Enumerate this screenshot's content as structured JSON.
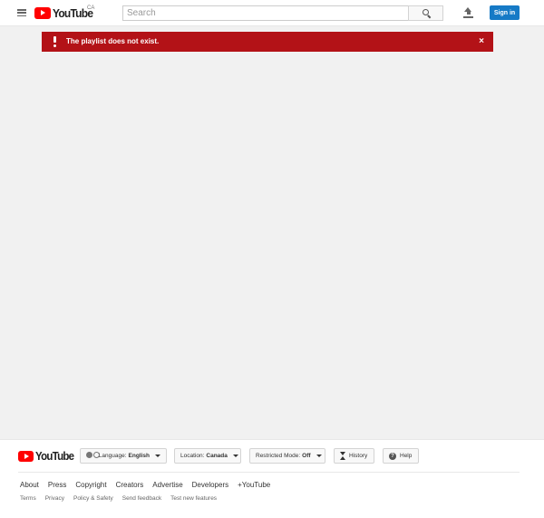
{
  "header": {
    "logo_text": "YouTube",
    "region": "CA",
    "search_placeholder": "Search",
    "sign_in_label": "Sign in"
  },
  "alert": {
    "message": "The playlist does not exist.",
    "close_label": "×"
  },
  "footer": {
    "logo_text": "YouTube",
    "language": {
      "label": "Language:",
      "value": "English"
    },
    "location": {
      "label": "Location:",
      "value": "Canada"
    },
    "restricted": {
      "label": "Restricted Mode:",
      "value": "Off"
    },
    "history_label": "History",
    "help_label": "Help",
    "help_glyph": "?",
    "primary_links": [
      "About",
      "Press",
      "Copyright",
      "Creators",
      "Advertise",
      "Developers",
      "+YouTube"
    ],
    "secondary_links": [
      "Terms",
      "Privacy",
      "Policy & Safety",
      "Send feedback",
      "Test new features"
    ]
  },
  "colors": {
    "brand_red": "#ff0000",
    "alert_red": "#b31217",
    "sign_in_blue": "#167ac6",
    "page_bg": "#f1f1f1"
  },
  "icons": {
    "menu": "hamburger-menu-icon",
    "search": "search-icon",
    "upload": "upload-icon",
    "alert": "exclamation-icon",
    "close": "close-icon",
    "language": "language-icon",
    "history": "hourglass-icon",
    "help": "help-icon"
  }
}
